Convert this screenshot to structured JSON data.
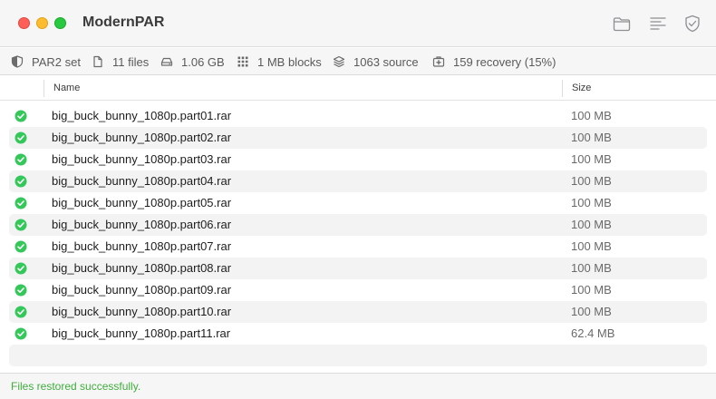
{
  "window": {
    "title": "ModernPAR"
  },
  "toolbar": {
    "icons": [
      "folder-icon",
      "list-icon",
      "shield-check-icon"
    ]
  },
  "info": {
    "set_label": "PAR2 set",
    "files": "11 files",
    "size": "1.06 GB",
    "blocks": "1 MB blocks",
    "source": "1063 source",
    "recovery": "159 recovery (15%)"
  },
  "table": {
    "columns": {
      "name": "Name",
      "size": "Size"
    },
    "rows": [
      {
        "name": "big_buck_bunny_1080p.part01.rar",
        "size": "100 MB",
        "status": "ok"
      },
      {
        "name": "big_buck_bunny_1080p.part02.rar",
        "size": "100 MB",
        "status": "ok"
      },
      {
        "name": "big_buck_bunny_1080p.part03.rar",
        "size": "100 MB",
        "status": "ok"
      },
      {
        "name": "big_buck_bunny_1080p.part04.rar",
        "size": "100 MB",
        "status": "ok"
      },
      {
        "name": "big_buck_bunny_1080p.part05.rar",
        "size": "100 MB",
        "status": "ok"
      },
      {
        "name": "big_buck_bunny_1080p.part06.rar",
        "size": "100 MB",
        "status": "ok"
      },
      {
        "name": "big_buck_bunny_1080p.part07.rar",
        "size": "100 MB",
        "status": "ok"
      },
      {
        "name": "big_buck_bunny_1080p.part08.rar",
        "size": "100 MB",
        "status": "ok"
      },
      {
        "name": "big_buck_bunny_1080p.part09.rar",
        "size": "100 MB",
        "status": "ok"
      },
      {
        "name": "big_buck_bunny_1080p.part10.rar",
        "size": "100 MB",
        "status": "ok"
      },
      {
        "name": "big_buck_bunny_1080p.part11.rar",
        "size": "62.4 MB",
        "status": "ok"
      }
    ]
  },
  "status": {
    "message": "Files restored successfully."
  },
  "colors": {
    "success": "#34c759",
    "status_text": "#3fae3c",
    "close": "#ff5f57",
    "minimize": "#febc2e",
    "maximize": "#28c840"
  }
}
